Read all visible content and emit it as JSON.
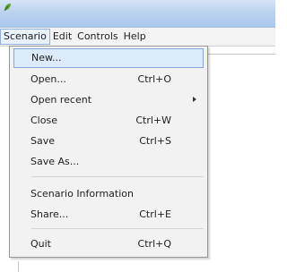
{
  "menubar": {
    "items": [
      {
        "label": "Scenario"
      },
      {
        "label": "Edit"
      },
      {
        "label": "Controls"
      },
      {
        "label": "Help"
      }
    ]
  },
  "scenario_menu": {
    "items": [
      {
        "label": "New...",
        "shortcut": ""
      },
      {
        "label": "Open...",
        "shortcut": "Ctrl+O"
      },
      {
        "label": "Open recent",
        "shortcut": ""
      },
      {
        "label": "Close",
        "shortcut": "Ctrl+W"
      },
      {
        "label": "Save",
        "shortcut": "Ctrl+S"
      },
      {
        "label": "Save As...",
        "shortcut": ""
      },
      {
        "label": "Scenario Information",
        "shortcut": ""
      },
      {
        "label": "Share...",
        "shortcut": "Ctrl+E"
      },
      {
        "label": "Quit",
        "shortcut": "Ctrl+Q"
      }
    ]
  },
  "colors": {
    "titlebar": "#bcd3ef",
    "highlight": "#dcebfa",
    "highlight_border": "#84a9d8"
  },
  "icons": {
    "app": "green-leaf-icon",
    "submenu": "triangle-right-icon"
  }
}
